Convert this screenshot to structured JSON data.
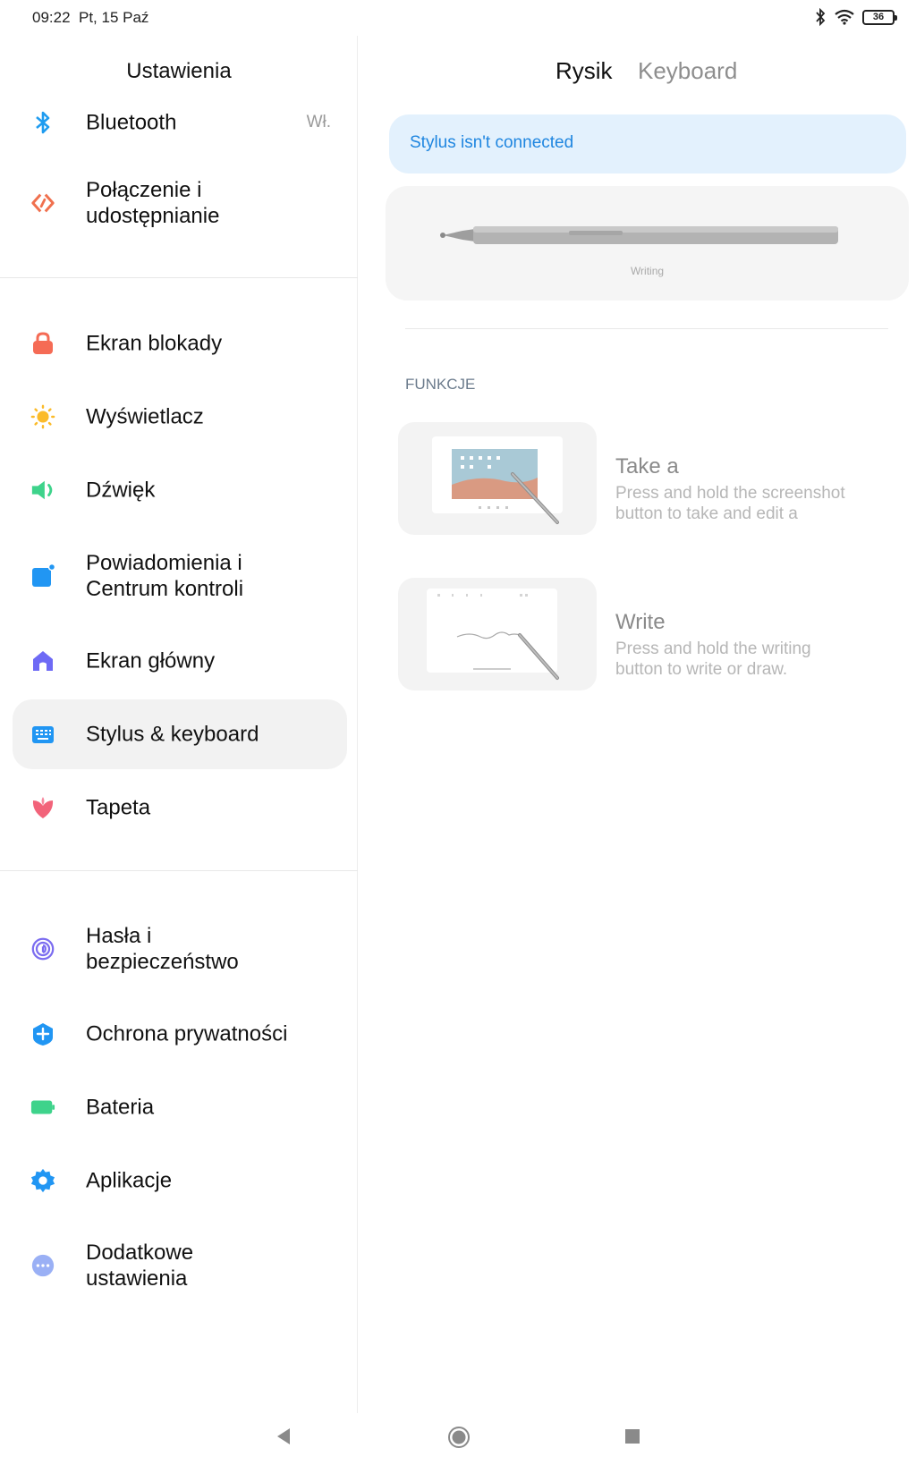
{
  "status_bar": {
    "time": "09:22",
    "date": "Pt, 15 Paź",
    "battery": "36",
    "icons": [
      "bluetooth-icon",
      "wifi-icon",
      "battery-icon"
    ]
  },
  "sidebar": {
    "title": "Ustawienia",
    "groups": [
      [
        {
          "label": "Bluetooth",
          "value": "Wł.",
          "icon": "bluetooth-icon"
        },
        {
          "label": "Połączenie i\nudostępnianie",
          "icon": "connection-share-icon"
        }
      ],
      [
        {
          "label": "Ekran blokady",
          "icon": "lock-icon"
        },
        {
          "label": "Wyświetlacz",
          "icon": "sun-icon"
        },
        {
          "label": "Dźwięk",
          "icon": "speaker-icon"
        },
        {
          "label": "Powiadomienia i\nCentrum kontroli",
          "icon": "notification-icon"
        },
        {
          "label": "Ekran główny",
          "icon": "home-icon"
        },
        {
          "label": "Stylus & keyboard",
          "icon": "keyboard-icon",
          "selected": true
        },
        {
          "label": "Tapeta",
          "icon": "flower-icon"
        }
      ],
      [
        {
          "label": "Hasła i\nbezpieczeństwo",
          "icon": "fingerprint-icon"
        },
        {
          "label": "Ochrona prywatności",
          "icon": "privacy-shield-icon"
        },
        {
          "label": "Bateria",
          "icon": "battery-icon"
        },
        {
          "label": "Aplikacje",
          "icon": "gear-icon"
        },
        {
          "label": "Dodatkowe\nustawienia",
          "icon": "more-icon"
        }
      ]
    ]
  },
  "main": {
    "tabs": [
      {
        "label": "Rysik",
        "active": true
      },
      {
        "label": "Keyboard",
        "active": false
      }
    ],
    "status_banner": "Stylus isn't connected",
    "stylus_caption": "Writing",
    "section_header": "FUNKCJE",
    "features": [
      {
        "title": "Take a",
        "description": "Press and hold the screenshot\nbutton to take and edit a"
      },
      {
        "title": "Write",
        "description": "Press and hold the writing\nbutton to write or draw."
      }
    ]
  },
  "colors": {
    "accent_blue": "#1f86e0",
    "banner_bg": "#e3f1fd",
    "selected_bg": "#f2f2f2"
  },
  "nav_bar": {
    "icons": [
      "back-icon",
      "home-button-icon",
      "recents-icon"
    ]
  }
}
